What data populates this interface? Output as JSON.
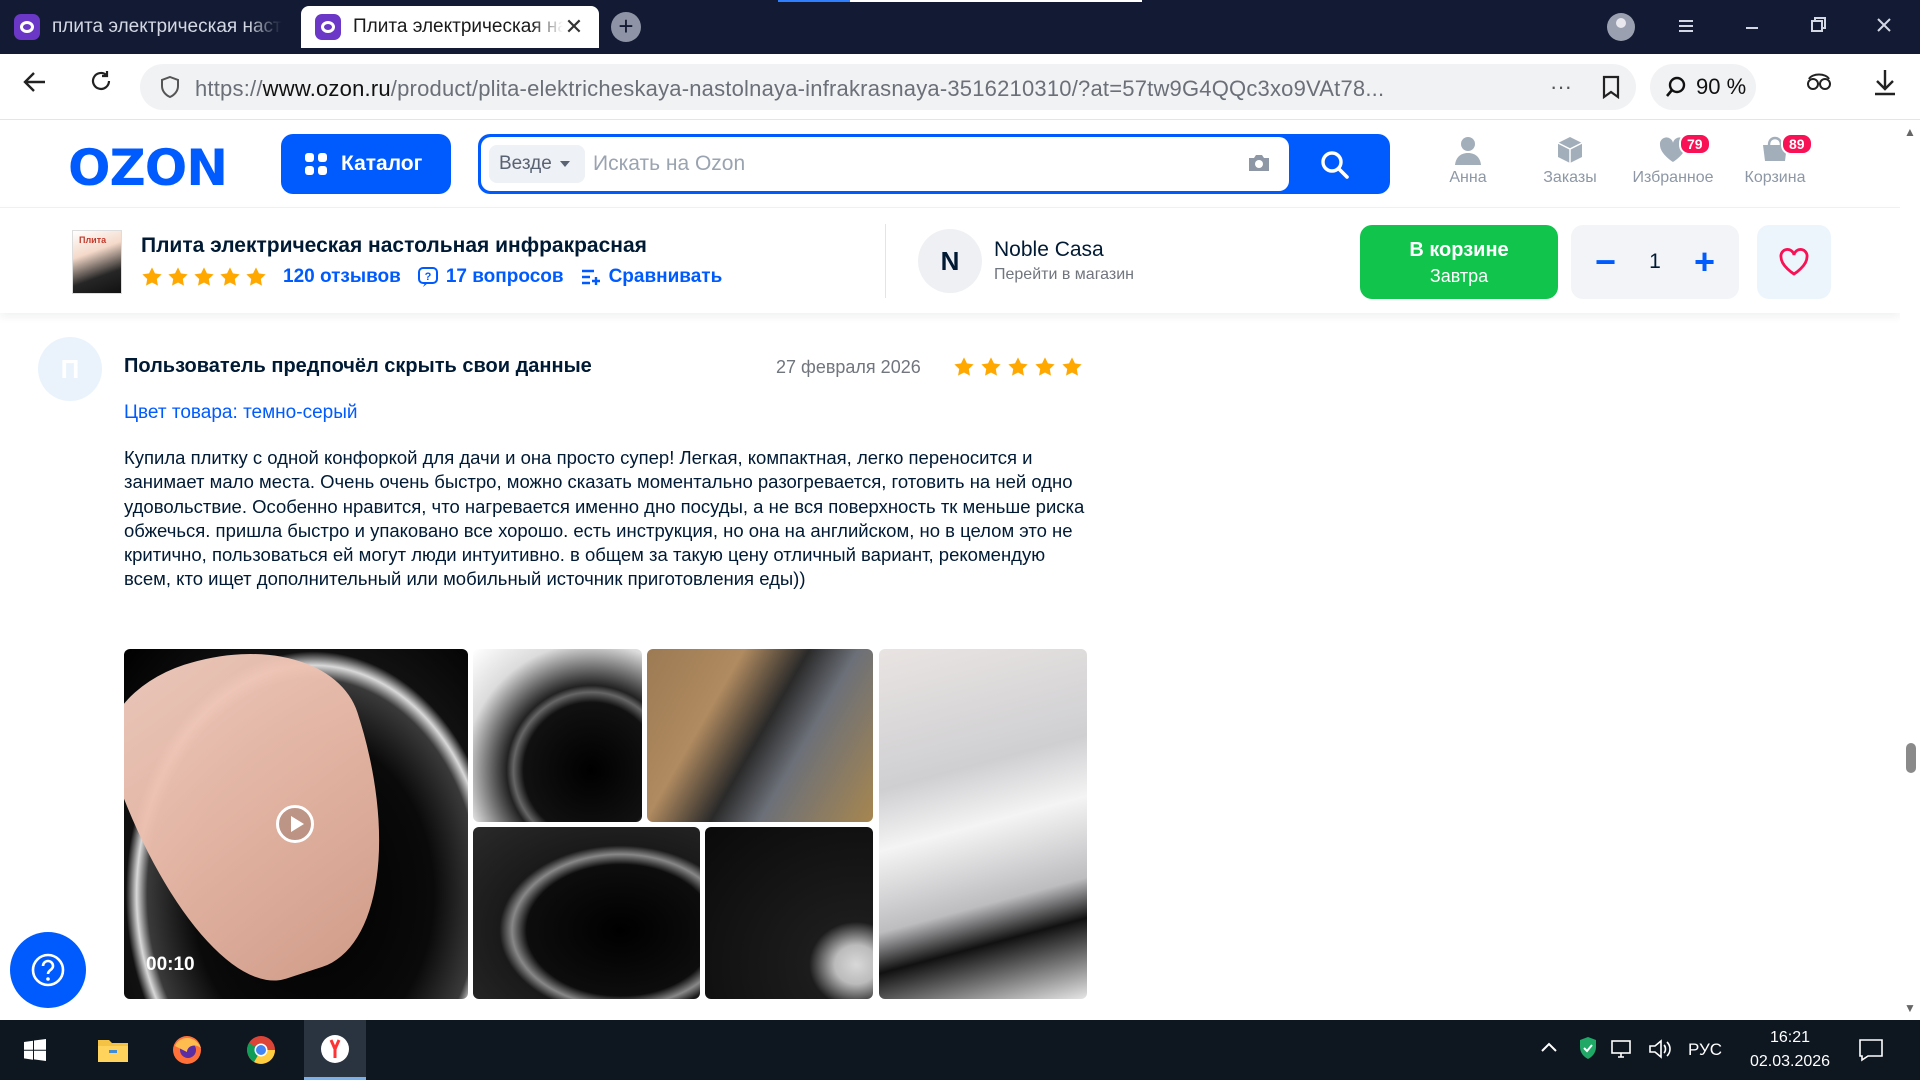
{
  "browser": {
    "tabs": [
      {
        "title": "плита электрическая настольная",
        "active": false
      },
      {
        "title": "Плита электрическая настольная",
        "active": true
      }
    ],
    "url_prefix": "https://",
    "url_domain": "www.ozon.ru",
    "url_path": "/product/plita-elektricheskaya-nastolnaya-infrakrasnaya-3516210310/?at=57tw9G4QQc3xo9VAt78...",
    "zoom": "90 %",
    "more_glyph": "···",
    "tab_close_glyph": "✕",
    "new_tab_glyph": "+"
  },
  "ozon_header": {
    "logo": "OZON",
    "catalog_label": "Каталог",
    "search_scope": "Везде",
    "search_placeholder": "Искать на Ozon",
    "nav": [
      {
        "label": "Анна",
        "icon": "user-icon"
      },
      {
        "label": "Заказы",
        "icon": "box-icon"
      },
      {
        "label": "Избранное",
        "icon": "heart-icon",
        "badge": "79"
      },
      {
        "label": "Корзина",
        "icon": "cart-icon",
        "badge": "89"
      }
    ],
    "brand_color": "#005bff"
  },
  "product_bar": {
    "thumb_text": "Плита",
    "title": "Плита электрическая настольная инфракрасная",
    "rating_stars": 5,
    "reviews_link": "120 отзывов",
    "questions_link": "17 вопросов",
    "compare_link": "Сравнивать",
    "seller_initial": "N",
    "seller_name": "Noble Casa",
    "seller_sub": "Перейти в магазин",
    "cart_label": "В корзине",
    "cart_sub": "Завтра",
    "cart_color": "#10c44c",
    "qty_minus": "−",
    "qty_plus": "+",
    "quantity": "1"
  },
  "review": {
    "avatar_initial": "П",
    "author": "Пользователь предпочёл скрыть свои данные",
    "date": "27 февраля 2026",
    "rating": 5,
    "color_label": "Цвет товара:",
    "color_value": "темно-серый",
    "text": "Купила плитку с одной конфоркой для дачи и она просто супер! Легкая, компактная, легко переносится и занимает мало места. Очень очень быстро, можно сказать моментально разогревается, готовить на ней одно удовольствие. Особенно нравится, что нагревается именно дно посуды, а не вся поверхность тк меньше риска обжечься. пришла быстро и упаковано все хорошо. есть инструкция, но она на английском, но в целом это не критично, пользоваться ей могут люди интуитивно. в общем за такую цену отличный вариант, рекомендую всем, кто ищет дополнительный или мобильный источник приготовления еды))",
    "video_duration": "00:10",
    "star_color": "#ffa800"
  },
  "taskbar": {
    "language": "РУС",
    "time": "16:21",
    "date": "02.03.2026"
  }
}
